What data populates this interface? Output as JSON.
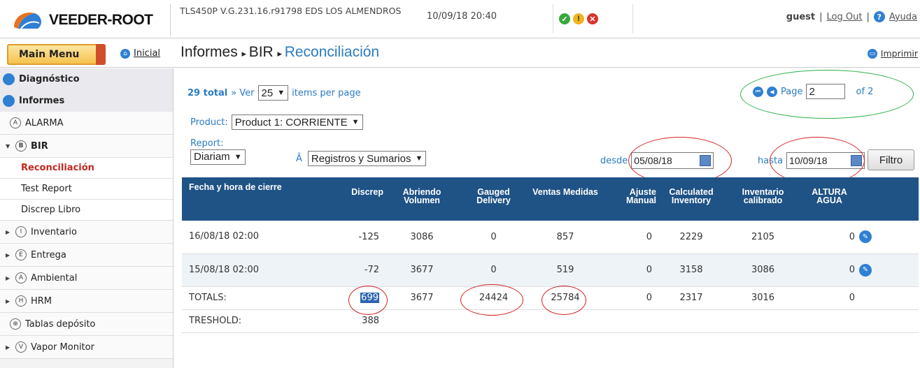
{
  "header": {
    "brand": "VEEDER-ROOT",
    "system": "TLS450P V.G.231.16.r91798 EDS LOS ALMENDROS",
    "datetime": "10/09/18 20:40",
    "user": "guest",
    "logout": "Log Out",
    "help": "Ayuda"
  },
  "nav": {
    "main_menu": "Main Menu",
    "home": "Inicial",
    "breadcrumb": [
      "Informes",
      "BIR",
      "Reconciliación"
    ],
    "print": "Imprimir"
  },
  "sidebar": {
    "top": [
      "Diagnóstico",
      "Informes"
    ],
    "items": [
      "ALARMA",
      "BIR",
      "Reconciliación",
      "Test Report",
      "Discrep Libro",
      "Inventario",
      "Entrega",
      "Ambiental",
      "HRM",
      "Tablas depósito",
      "Vapor Monitor"
    ]
  },
  "pager": {
    "total": "29 total",
    "ver": "» Ver",
    "per_page": "25",
    "items_label": "items per page",
    "page_label": "Page",
    "page": "2",
    "of": "of 2"
  },
  "filters": {
    "product_label": "Product:",
    "product": "Product 1: CORRIENTE",
    "report_label": "Report:",
    "report": "Diariam",
    "type_prefix": "Â",
    "type": "Registros y Sumarios",
    "desde_label": "desde",
    "desde": "05/08/18",
    "hasta_label": "hasta",
    "hasta": "10/09/18",
    "filtro": "Filtro"
  },
  "table": {
    "headers": [
      "Fecha y hora de cierre",
      "Discrep",
      "Abriendo Volumen",
      "Gauged Delivery",
      "Ventas Medidas",
      "Ajuste Manual",
      "Calculated Inventory",
      "Inventario calibrado",
      "ALTURA AGUA"
    ],
    "rows": [
      [
        "16/08/18 02:00",
        "-125",
        "3086",
        "0",
        "857",
        "0",
        "2229",
        "2105",
        "0"
      ],
      [
        "15/08/18 02:00",
        "-72",
        "3677",
        "0",
        "519",
        "0",
        "3158",
        "3086",
        "0"
      ]
    ],
    "totals": [
      "TOTALS:",
      "699",
      "3677",
      "24424",
      "25784",
      "0",
      "2317",
      "3016",
      "0"
    ],
    "treshold": [
      "TRESHOLD:",
      "388"
    ]
  },
  "colors": {
    "header_bg": "#1f5285",
    "link_blue": "#2a7bc1",
    "annotation_red": "#d42020",
    "annotation_green": "#2cb04a"
  }
}
